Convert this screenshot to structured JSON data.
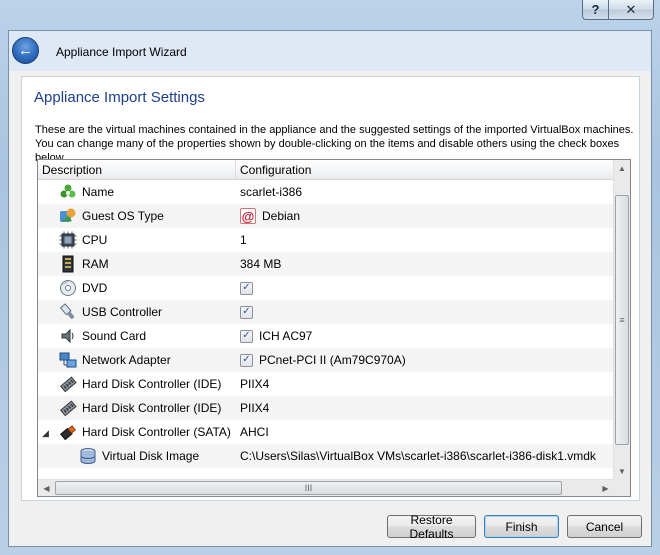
{
  "window": {
    "help_glyph": "?",
    "close_glyph": "✕"
  },
  "wizard": {
    "back_glyph": "←",
    "title": "Appliance Import Wizard"
  },
  "page": {
    "section_title": "Appliance Import Settings",
    "description": "These are the virtual machines contained in the appliance and the suggested settings of the imported VirtualBox machines. You can change many of the properties shown by double-clicking on the items and disable others using the check boxes below."
  },
  "table": {
    "columns": [
      "Description",
      "Configuration"
    ],
    "rows": [
      {
        "icon": "name-icon",
        "label": "Name",
        "value": "scarlet-i386",
        "checkbox": false
      },
      {
        "icon": "guest-os-icon",
        "label": "Guest OS Type",
        "value": "Debian",
        "checkbox": false,
        "os_logo": "@"
      },
      {
        "icon": "cpu-icon",
        "label": "CPU",
        "value": "1",
        "checkbox": false
      },
      {
        "icon": "ram-icon",
        "label": "RAM",
        "value": "384 MB",
        "checkbox": false
      },
      {
        "icon": "dvd-icon",
        "label": "DVD",
        "value": "",
        "checkbox": true
      },
      {
        "icon": "usb-icon",
        "label": "USB Controller",
        "value": "",
        "checkbox": true
      },
      {
        "icon": "sound-card-icon",
        "label": "Sound Card",
        "value": "ICH AC97",
        "checkbox": true
      },
      {
        "icon": "network-adapter-icon",
        "label": "Network Adapter",
        "value": "PCnet-PCI II (Am79C970A)",
        "checkbox": true
      },
      {
        "icon": "ide-controller-icon",
        "label": "Hard Disk Controller (IDE)",
        "value": "PIIX4",
        "checkbox": false
      },
      {
        "icon": "ide-controller-icon",
        "label": "Hard Disk Controller (IDE)",
        "value": "PIIX4",
        "checkbox": false
      },
      {
        "icon": "sata-controller-icon",
        "label": "Hard Disk Controller (SATA)",
        "value": "AHCI",
        "checkbox": false,
        "expanded": true
      },
      {
        "icon": "virtual-disk-icon",
        "label": "Virtual Disk Image",
        "value": "C:\\Users\\Silas\\VirtualBox VMs\\scarlet-i386\\scarlet-i386-disk1.vmdk",
        "checkbox": false,
        "child": true
      }
    ],
    "checkmark": "✓",
    "expander_glyph": "◢"
  },
  "scrollbars": {
    "up": "▲",
    "down": "▼",
    "left": "◀",
    "right": "▶",
    "grip_v": "≡",
    "grip_h": "III"
  },
  "buttons": {
    "restore_defaults": "Restore Defaults",
    "finish": "Finish",
    "cancel": "Cancel"
  }
}
